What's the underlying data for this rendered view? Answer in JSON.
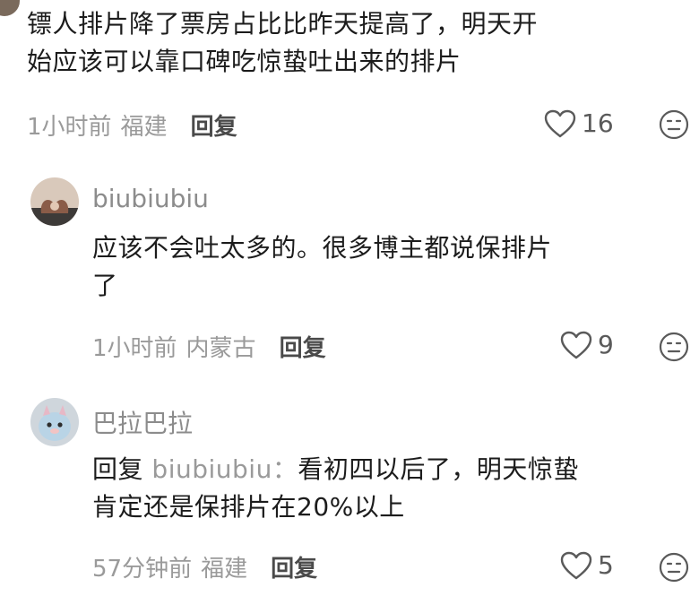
{
  "comments": [
    {
      "text_line1": "镖人排片降了票房占比比昨天提高了，明天开",
      "text_line2": "始应该可以靠口碑吃惊蛰吐出来的排片",
      "time": "1小时前",
      "location": "福建",
      "reply_label": "回复",
      "likes": "16"
    },
    {
      "username": "biubiubiu",
      "text_line1": "应该不会吐太多的。很多博主都说保排片",
      "text_line2": "了",
      "time": "1小时前",
      "location": "内蒙古",
      "reply_label": "回复",
      "likes": "9"
    },
    {
      "username": "巴拉巴拉",
      "reply_prefix": "回复",
      "reply_target": "biubiubiu：",
      "text_line1": "看初四以后了，明天惊蛰",
      "text_line2": "肯定还是保排片在20%以上",
      "time": "57分钟前",
      "location": "福建",
      "reply_label": "回复",
      "likes": "5"
    }
  ],
  "colors": {
    "text": "#1c1c1c",
    "meta": "#9a9a9a",
    "username": "#8c8c8c",
    "icon": "#5a5a5a"
  },
  "icons": [
    "heart-icon",
    "emoji-icon"
  ]
}
